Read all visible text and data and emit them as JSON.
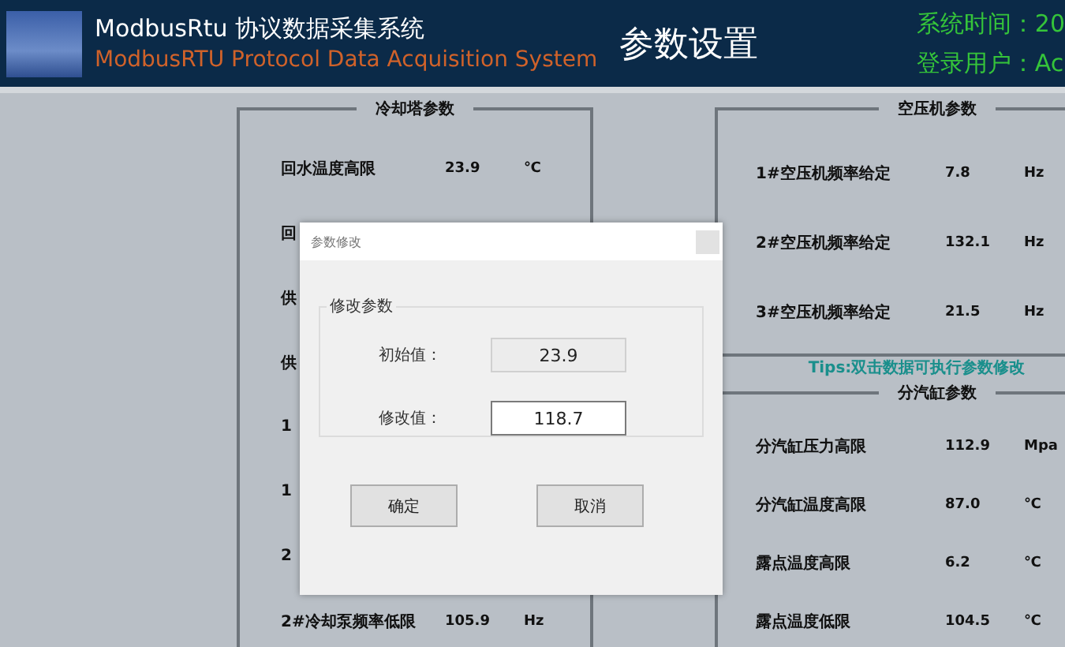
{
  "header": {
    "title": "ModbusRtu 协议数据采集系统",
    "subtitle": "ModbusRTU Protocol Data Acquisition System",
    "page_title": "参数设置",
    "system_time": "系统时间：20",
    "login_user": "登录用户：Ac"
  },
  "left_groups": [
    {
      "title": "冷却塔参数",
      "rows": [
        {
          "label": "回水温度高限",
          "value": "23.9",
          "unit": "℃"
        },
        {
          "label": "回"
        },
        {
          "label": "供"
        },
        {
          "label": "供"
        },
        {
          "label": "1"
        },
        {
          "label": "1"
        },
        {
          "label": "2"
        },
        {
          "label": "2#冷却泵频率低限",
          "value": "105.9",
          "unit": "Hz"
        }
      ]
    }
  ],
  "right_groups": [
    {
      "title": "空压机参数",
      "rows": [
        {
          "label": "1#空压机频率给定",
          "value": "7.8",
          "unit": "Hz"
        },
        {
          "label": "2#空压机频率给定",
          "value": "132.1",
          "unit": "Hz"
        },
        {
          "label": "3#空压机频率给定",
          "value": "21.5",
          "unit": "Hz"
        }
      ]
    },
    {
      "title": "分汽缸参数",
      "rows": [
        {
          "label": "分汽缸压力高限",
          "value": "112.9",
          "unit": "Mpa"
        },
        {
          "label": "分汽缸温度高限",
          "value": "87.0",
          "unit": "℃"
        },
        {
          "label": "露点温度高限",
          "value": "6.2",
          "unit": "℃"
        },
        {
          "label": "露点温度低限",
          "value": "104.5",
          "unit": "℃"
        }
      ]
    }
  ],
  "tips": "Tips:双击数据可执行参数修改",
  "dialog": {
    "title": "参数修改",
    "group_title": "修改参数",
    "fields": [
      {
        "label": "初始值：",
        "value": "23.9",
        "kind": "readonly"
      },
      {
        "label": "修改值：",
        "value": "118.7",
        "kind": "editable"
      }
    ],
    "buttons": [
      "确定",
      "取消"
    ]
  }
}
